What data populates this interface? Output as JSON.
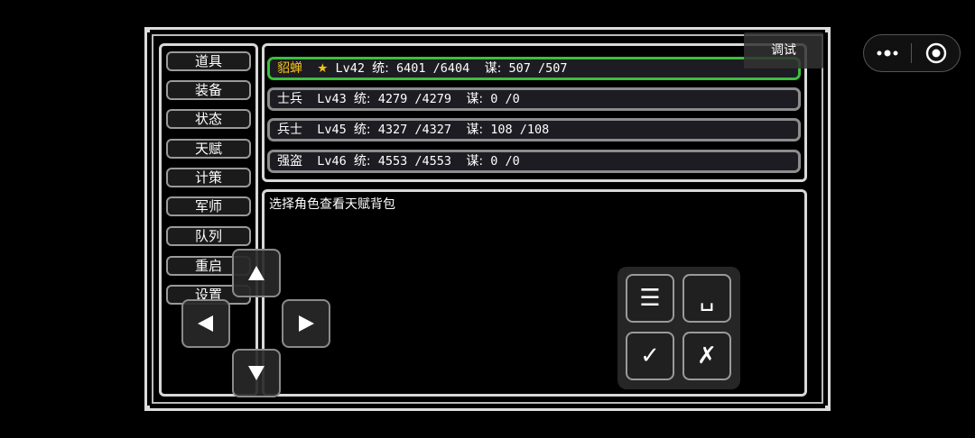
{
  "menu": [
    "道具",
    "装备",
    "状态",
    "天赋",
    "计策",
    "军师",
    "队列",
    "重启",
    "设置"
  ],
  "units": [
    {
      "name": "貂蝉",
      "star": "★",
      "level": "Lv42",
      "tong_label": "统:",
      "tong": "6401 /6404",
      "mou_label": "谋:",
      "mou": "507 /507",
      "selected": true
    },
    {
      "name": "士兵",
      "star": "",
      "level": "Lv43",
      "tong_label": "统:",
      "tong": "4279 /4279",
      "mou_label": "谋:",
      "mou": "0 /0",
      "selected": false
    },
    {
      "name": "兵士",
      "star": "",
      "level": "Lv45",
      "tong_label": "统:",
      "tong": "4327 /4327",
      "mou_label": "谋:",
      "mou": "108 /108",
      "selected": false
    },
    {
      "name": "强盗",
      "star": "",
      "level": "Lv46",
      "tong_label": "统:",
      "tong": "4553 /4553",
      "mou_label": "谋:",
      "mou": "0 /0",
      "selected": false
    }
  ],
  "description": "选择角色查看天赋背包",
  "debug_label": "调试",
  "dpad": {
    "up": "up-arrow-icon",
    "down": "down-arrow-icon",
    "left": "left-arrow-icon",
    "right": "right-arrow-icon"
  },
  "actions": {
    "menu": "☰",
    "space": "␣",
    "confirm": "✓",
    "cancel": "✗"
  },
  "colors": {
    "selected_border": "#3bbf3b",
    "selected_name": "#f2c21b",
    "background": "#000000"
  }
}
